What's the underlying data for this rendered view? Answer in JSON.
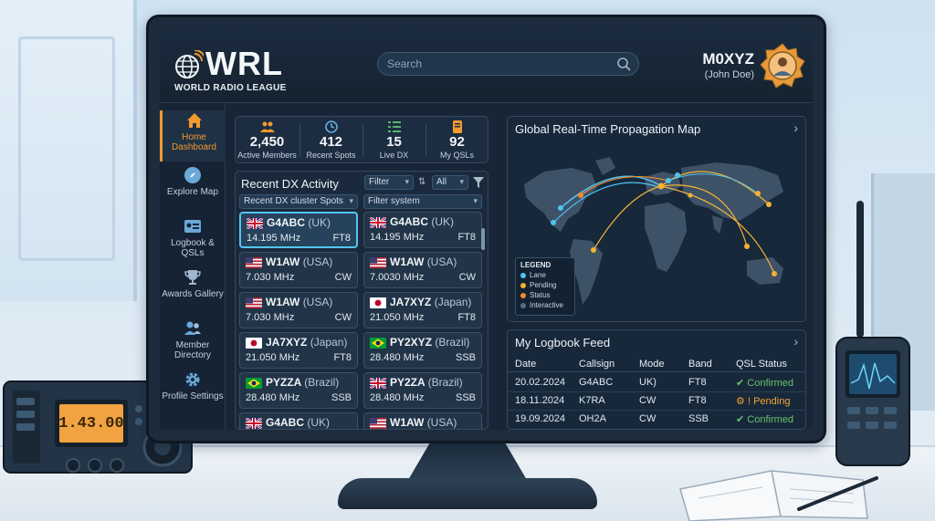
{
  "brand": {
    "name": "WRL",
    "subtitle": "WORLD RADIO LEAGUE"
  },
  "search": {
    "placeholder": "Search"
  },
  "user": {
    "callsign": "M0XYZ",
    "name": "(John Doe)"
  },
  "sidebar": {
    "items": [
      {
        "label": "Home Dashboard",
        "icon": "home-icon",
        "active": true
      },
      {
        "label": "Explore Map",
        "icon": "compass-icon",
        "active": false
      },
      {
        "label": "Logbook & QSLs",
        "icon": "id-card-icon",
        "active": false
      },
      {
        "label": "Awards Gallery",
        "icon": "trophy-icon",
        "active": false
      },
      {
        "label": "Member Directory",
        "icon": "members-icon",
        "active": false
      },
      {
        "label": "Profile Settings",
        "icon": "gear-icon",
        "active": false
      }
    ]
  },
  "stats": [
    {
      "value": "2,450",
      "label": "Active Members",
      "icon": "people-icon"
    },
    {
      "value": "412",
      "label": "Recent Spots",
      "icon": "clock-icon"
    },
    {
      "value": "15",
      "label": "Live DX",
      "icon": "list-icon"
    },
    {
      "value": "92",
      "label": "My QSLs",
      "icon": "book-icon"
    }
  ],
  "dx": {
    "title": "Recent DX Activity",
    "filter_label": "Filter",
    "all_label": "All",
    "source_select": "Recent DX cluster Spots",
    "system_select": "Filter system",
    "spots": [
      {
        "call": "G4ABC",
        "country": "(UK)",
        "freq": "14.195 MHz",
        "mode": "FT8",
        "flag": "uk",
        "highlight": true
      },
      {
        "call": "G4ABC",
        "country": "(UK)",
        "freq": "14.195 MHz",
        "mode": "FT8",
        "flag": "uk",
        "highlight": false
      },
      {
        "call": "W1AW",
        "country": "(USA)",
        "freq": "7.030 MHz",
        "mode": "CW",
        "flag": "usa",
        "highlight": false
      },
      {
        "call": "W1AW",
        "country": "(USA)",
        "freq": "7.0030 MHz",
        "mode": "CW",
        "flag": "usa",
        "highlight": false
      },
      {
        "call": "W1AW",
        "country": "(USA)",
        "freq": "7.030 MHz",
        "mode": "CW",
        "flag": "usa",
        "highlight": false
      },
      {
        "call": "JA7XYZ",
        "country": "(Japan)",
        "freq": "21.050 MHz",
        "mode": "FT8",
        "flag": "japan",
        "highlight": false
      },
      {
        "call": "JA7XYZ",
        "country": "(Japan)",
        "freq": "21.050 MHz",
        "mode": "FT8",
        "flag": "japan",
        "highlight": false
      },
      {
        "call": "PY2XYZ",
        "country": "(Brazil)",
        "freq": "28.480 MHz",
        "mode": "SSB",
        "flag": "brazil",
        "highlight": false
      },
      {
        "call": "PYZZA",
        "country": "(Brazil)",
        "freq": "28.480 MHz",
        "mode": "SSB",
        "flag": "brazil",
        "highlight": false
      },
      {
        "call": "PY2ZA",
        "country": "(Brazil)",
        "freq": "28.480 MHz",
        "mode": "SSB",
        "flag": "uk",
        "highlight": false
      },
      {
        "call": "G4ABC",
        "country": "(UK)",
        "freq": "",
        "mode": "",
        "flag": "uk",
        "highlight": false
      },
      {
        "call": "W1AW",
        "country": "(USA)",
        "freq": "",
        "mode": "",
        "flag": "usa",
        "highlight": false
      }
    ]
  },
  "map": {
    "title": "Global Real-Time Propagation Map",
    "legend": {
      "title": "LEGEND",
      "items": [
        {
          "label": "Lane",
          "color": "#4fc3f0"
        },
        {
          "label": "Pending",
          "color": "#f2b233"
        },
        {
          "label": "Status",
          "color": "#f28b2e"
        },
        {
          "label": "Interactive",
          "color": "#5b6d80"
        }
      ]
    }
  },
  "logbook": {
    "title": "My Logbook Feed",
    "columns": [
      "Date",
      "Callsign",
      "Mode",
      "Band",
      "QSL Status"
    ],
    "rows": [
      {
        "date": "20.02.2024",
        "call": "G4ABC",
        "mode": "UK)",
        "band": "FT8",
        "status": "Confirmed",
        "state": "ok"
      },
      {
        "date": "18.11.2024",
        "call": "K7RA",
        "mode": "CW",
        "band": "FT8",
        "status": "Pending",
        "state": "pending"
      },
      {
        "date": "19.09.2024",
        "call": "OH2A",
        "mode": "CW",
        "band": "SSB",
        "status": "Confirmed",
        "state": "ok"
      }
    ]
  },
  "radio": {
    "display": "1.43.00"
  },
  "colors": {
    "accent": "#f29a2e",
    "highlight": "#53c4f0",
    "confirmed": "#66c36b",
    "pending": "#f0a531"
  }
}
